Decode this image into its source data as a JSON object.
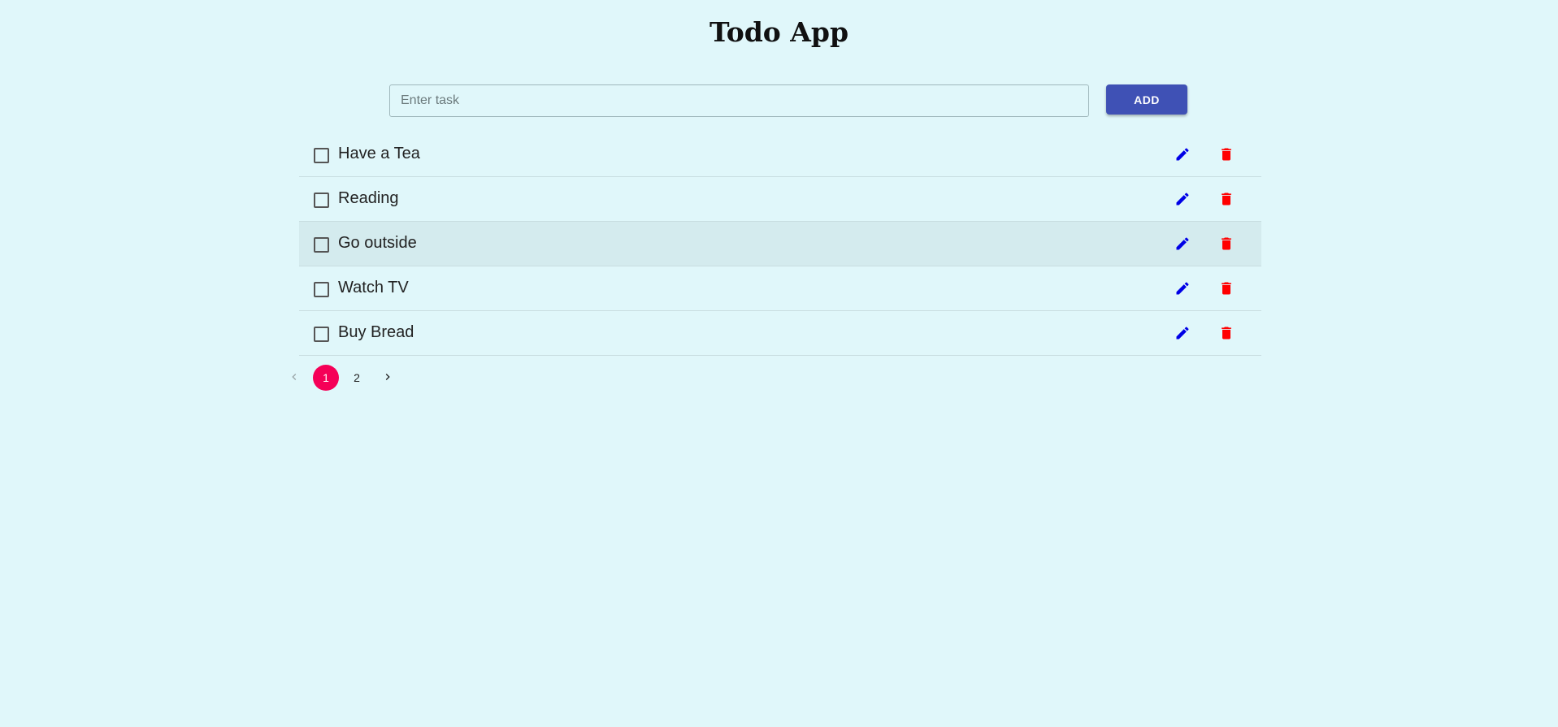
{
  "app": {
    "title": "Todo App"
  },
  "input": {
    "placeholder": "Enter task",
    "value": ""
  },
  "add_button": {
    "label": "ADD"
  },
  "tasks": [
    {
      "label": "Have a Tea",
      "checked": false
    },
    {
      "label": "Reading",
      "checked": false
    },
    {
      "label": "Go outside",
      "checked": false
    },
    {
      "label": "Watch TV",
      "checked": false
    },
    {
      "label": "Buy Bread",
      "checked": false
    }
  ],
  "task_icons": {
    "edit": "pencil-icon",
    "delete": "trash-icon"
  },
  "pagination": {
    "pages": [
      "1",
      "2"
    ],
    "current_page": "1",
    "prev_icon": "chevron-left-icon",
    "next_icon": "chevron-right-icon"
  },
  "colors": {
    "background": "#e0f7fa",
    "add_button": "#3f51b5",
    "edit_icon": "#0000e6",
    "delete_icon": "#ff0000",
    "current_page": "#f50057",
    "hover_row": "#d4ebee"
  }
}
